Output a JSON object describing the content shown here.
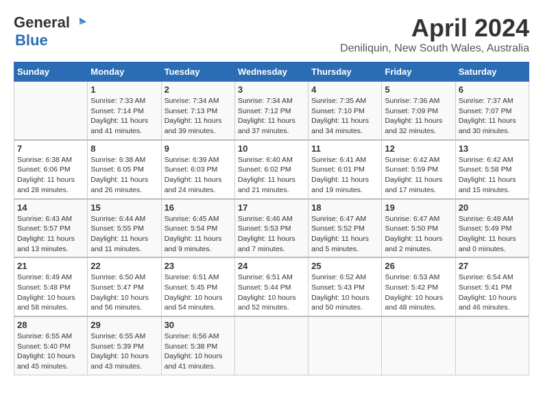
{
  "logo": {
    "line1": "General",
    "bird": "▶",
    "line2": "Blue"
  },
  "title": "April 2024",
  "subtitle": "Deniliquin, New South Wales, Australia",
  "days_header": [
    "Sunday",
    "Monday",
    "Tuesday",
    "Wednesday",
    "Thursday",
    "Friday",
    "Saturday"
  ],
  "weeks": [
    {
      "cells": [
        {
          "day": "",
          "info": ""
        },
        {
          "day": "1",
          "info": "Sunrise: 7:33 AM\nSunset: 7:14 PM\nDaylight: 11 hours\nand 41 minutes."
        },
        {
          "day": "2",
          "info": "Sunrise: 7:34 AM\nSunset: 7:13 PM\nDaylight: 11 hours\nand 39 minutes."
        },
        {
          "day": "3",
          "info": "Sunrise: 7:34 AM\nSunset: 7:12 PM\nDaylight: 11 hours\nand 37 minutes."
        },
        {
          "day": "4",
          "info": "Sunrise: 7:35 AM\nSunset: 7:10 PM\nDaylight: 11 hours\nand 34 minutes."
        },
        {
          "day": "5",
          "info": "Sunrise: 7:36 AM\nSunset: 7:09 PM\nDaylight: 11 hours\nand 32 minutes."
        },
        {
          "day": "6",
          "info": "Sunrise: 7:37 AM\nSunset: 7:07 PM\nDaylight: 11 hours\nand 30 minutes."
        }
      ]
    },
    {
      "cells": [
        {
          "day": "7",
          "info": "Sunrise: 6:38 AM\nSunset: 6:06 PM\nDaylight: 11 hours\nand 28 minutes."
        },
        {
          "day": "8",
          "info": "Sunrise: 6:38 AM\nSunset: 6:05 PM\nDaylight: 11 hours\nand 26 minutes."
        },
        {
          "day": "9",
          "info": "Sunrise: 6:39 AM\nSunset: 6:03 PM\nDaylight: 11 hours\nand 24 minutes."
        },
        {
          "day": "10",
          "info": "Sunrise: 6:40 AM\nSunset: 6:02 PM\nDaylight: 11 hours\nand 21 minutes."
        },
        {
          "day": "11",
          "info": "Sunrise: 6:41 AM\nSunset: 6:01 PM\nDaylight: 11 hours\nand 19 minutes."
        },
        {
          "day": "12",
          "info": "Sunrise: 6:42 AM\nSunset: 5:59 PM\nDaylight: 11 hours\nand 17 minutes."
        },
        {
          "day": "13",
          "info": "Sunrise: 6:42 AM\nSunset: 5:58 PM\nDaylight: 11 hours\nand 15 minutes."
        }
      ]
    },
    {
      "cells": [
        {
          "day": "14",
          "info": "Sunrise: 6:43 AM\nSunset: 5:57 PM\nDaylight: 11 hours\nand 13 minutes."
        },
        {
          "day": "15",
          "info": "Sunrise: 6:44 AM\nSunset: 5:55 PM\nDaylight: 11 hours\nand 11 minutes."
        },
        {
          "day": "16",
          "info": "Sunrise: 6:45 AM\nSunset: 5:54 PM\nDaylight: 11 hours\nand 9 minutes."
        },
        {
          "day": "17",
          "info": "Sunrise: 6:46 AM\nSunset: 5:53 PM\nDaylight: 11 hours\nand 7 minutes."
        },
        {
          "day": "18",
          "info": "Sunrise: 6:47 AM\nSunset: 5:52 PM\nDaylight: 11 hours\nand 5 minutes."
        },
        {
          "day": "19",
          "info": "Sunrise: 6:47 AM\nSunset: 5:50 PM\nDaylight: 11 hours\nand 2 minutes."
        },
        {
          "day": "20",
          "info": "Sunrise: 6:48 AM\nSunset: 5:49 PM\nDaylight: 11 hours\nand 0 minutes."
        }
      ]
    },
    {
      "cells": [
        {
          "day": "21",
          "info": "Sunrise: 6:49 AM\nSunset: 5:48 PM\nDaylight: 10 hours\nand 58 minutes."
        },
        {
          "day": "22",
          "info": "Sunrise: 6:50 AM\nSunset: 5:47 PM\nDaylight: 10 hours\nand 56 minutes."
        },
        {
          "day": "23",
          "info": "Sunrise: 6:51 AM\nSunset: 5:45 PM\nDaylight: 10 hours\nand 54 minutes."
        },
        {
          "day": "24",
          "info": "Sunrise: 6:51 AM\nSunset: 5:44 PM\nDaylight: 10 hours\nand 52 minutes."
        },
        {
          "day": "25",
          "info": "Sunrise: 6:52 AM\nSunset: 5:43 PM\nDaylight: 10 hours\nand 50 minutes."
        },
        {
          "day": "26",
          "info": "Sunrise: 6:53 AM\nSunset: 5:42 PM\nDaylight: 10 hours\nand 48 minutes."
        },
        {
          "day": "27",
          "info": "Sunrise: 6:54 AM\nSunset: 5:41 PM\nDaylight: 10 hours\nand 46 minutes."
        }
      ]
    },
    {
      "cells": [
        {
          "day": "28",
          "info": "Sunrise: 6:55 AM\nSunset: 5:40 PM\nDaylight: 10 hours\nand 45 minutes."
        },
        {
          "day": "29",
          "info": "Sunrise: 6:55 AM\nSunset: 5:39 PM\nDaylight: 10 hours\nand 43 minutes."
        },
        {
          "day": "30",
          "info": "Sunrise: 6:56 AM\nSunset: 5:38 PM\nDaylight: 10 hours\nand 41 minutes."
        },
        {
          "day": "",
          "info": ""
        },
        {
          "day": "",
          "info": ""
        },
        {
          "day": "",
          "info": ""
        },
        {
          "day": "",
          "info": ""
        }
      ]
    }
  ]
}
